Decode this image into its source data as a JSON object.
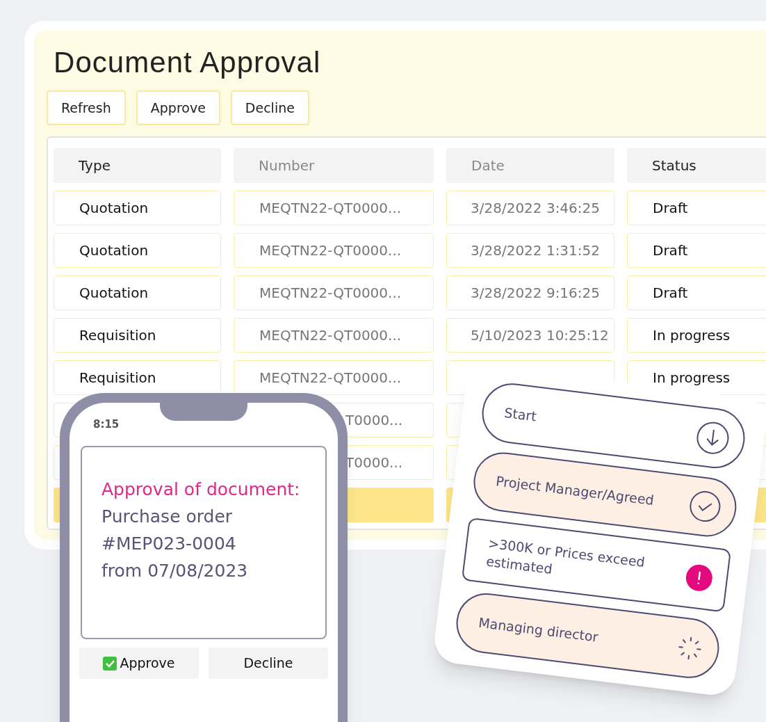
{
  "title": "Document Approval",
  "toolbar": [
    "Refresh",
    "Approve",
    "Decline"
  ],
  "table": {
    "columns": [
      {
        "label": "Type",
        "dim": false
      },
      {
        "label": "Number",
        "dim": true
      },
      {
        "label": "Date",
        "dim": true
      },
      {
        "label": "Status",
        "dim": false
      }
    ],
    "rows": [
      {
        "cells": [
          "Quotation",
          "MEQTN22-QT0000...",
          "3/28/2022 3:46:25",
          "Draft"
        ]
      },
      {
        "cells": [
          "Quotation",
          "MEQTN22-QT0000...",
          "3/28/2022 1:31:52",
          "Draft"
        ]
      },
      {
        "cells": [
          "Quotation",
          "MEQTN22-QT0000...",
          "3/28/2022 9:16:25",
          "Draft"
        ]
      },
      {
        "cells": [
          "Requisition",
          "MEQTN22-QT0000...",
          "5/10/2023 10:25:12",
          "In progress"
        ]
      },
      {
        "cells": [
          "Requisition",
          "MEQTN22-QT0000...",
          null,
          "In progress"
        ]
      },
      {
        "cells": [
          null,
          "T0000...",
          null,
          null
        ]
      },
      {
        "cells": [
          null,
          "T0000...",
          null,
          null
        ]
      }
    ]
  },
  "phone": {
    "time": "8:15",
    "heading": "Approval of document:",
    "lines": [
      "Purchase order",
      "#MEP023-0004",
      "from 07/08/2023"
    ],
    "buttons": [
      {
        "label": "Approve",
        "kind": "approve"
      },
      {
        "label": "Decline",
        "kind": "decline"
      }
    ]
  },
  "workflow": [
    {
      "label": "Start",
      "kind": "start"
    },
    {
      "label": "Project Manager/Agreed",
      "kind": "done"
    },
    {
      "label": ">300K or Prices exceed estimated",
      "kind": "warning"
    },
    {
      "label": "Managing director",
      "kind": "pending"
    }
  ]
}
